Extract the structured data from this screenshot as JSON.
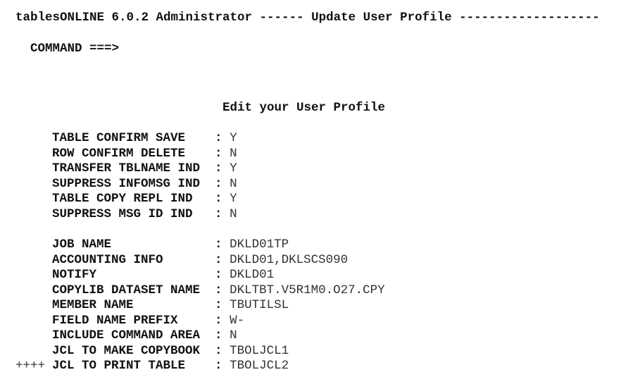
{
  "header": {
    "title_line": "tablesONLINE 6.0.2 Administrator ------ Update User Profile -------------------",
    "command_label": "COMMAND ===>",
    "command_value": ""
  },
  "panel": {
    "heading": "Edit your User Profile",
    "separator": " : ",
    "group1": [
      {
        "label": "TABLE CONFIRM SAVE   ",
        "value": "Y"
      },
      {
        "label": "ROW CONFIRM DELETE   ",
        "value": "N"
      },
      {
        "label": "TRANSFER TBLNAME IND ",
        "value": "Y"
      },
      {
        "label": "SUPPRESS INFOMSG IND ",
        "value": "N"
      },
      {
        "label": "TABLE COPY REPL IND  ",
        "value": "Y"
      },
      {
        "label": "SUPPRESS MSG ID IND  ",
        "value": "N"
      }
    ],
    "group2": [
      {
        "label": "JOB NAME             ",
        "value": "DKLD01TP"
      },
      {
        "label": "ACCOUNTING INFO      ",
        "value": "DKLD01,DKLSCS090"
      },
      {
        "label": "NOTIFY               ",
        "value": "DKLD01"
      },
      {
        "label": "COPYLIB DATASET NAME ",
        "value": "DKLTBT.V5R1M0.O27.CPY"
      },
      {
        "label": "MEMBER NAME          ",
        "value": "TBUTILSL"
      },
      {
        "label": "FIELD NAME PREFIX    ",
        "value": "W-"
      },
      {
        "label": "INCLUDE COMMAND AREA ",
        "value": "N"
      },
      {
        "label": "JCL TO MAKE COPYBOOK ",
        "value": "TBOLJCL1"
      },
      {
        "label": "JCL TO PRINT TABLE   ",
        "value": "TBOLJCL2"
      }
    ],
    "more_indicator": "++++"
  }
}
